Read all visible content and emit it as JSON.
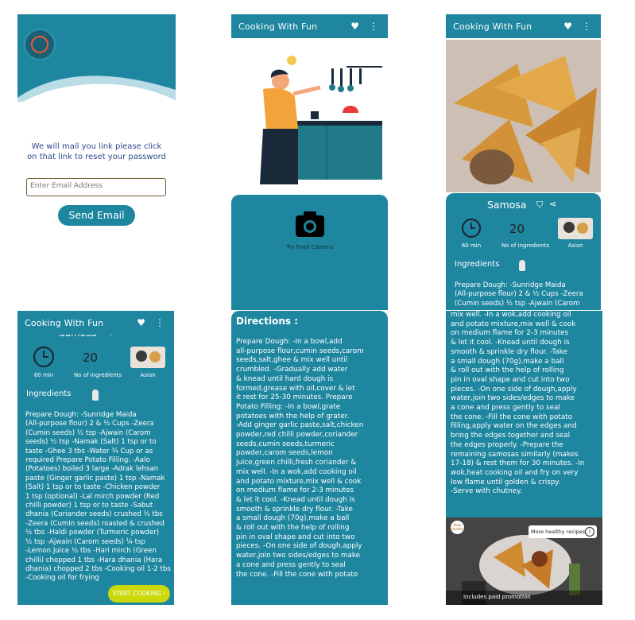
{
  "app": {
    "title": "Cooking With Fun"
  },
  "colors": {
    "primary": "#1f86a0",
    "button": "#cbd90b",
    "light_bg": "#ffffff"
  },
  "reset": {
    "message": "We will mail you link please click\non that link to reset your password",
    "email_placeholder": "Enter Email Address",
    "send_button": "Send Email"
  },
  "camera": {
    "label": "Try Food Camera"
  },
  "recipe": {
    "name": "Samosa",
    "name_partial": "Samosa",
    "time": "60 min",
    "ingredients_count": "20",
    "ingredients_count_label": "No of ingredients",
    "cuisine": "Asian",
    "ingredients_heading": "Ingredients",
    "ingredients_preview": "Prepare Dough: -Sunridge Maida\n(All-purpose flour) 2 & ½ Cups -Zeera\n(Cumin seeds) ½ tsp -Ajwain (Carom",
    "ingredients_full": "Prepare Dough: -Sunridge Maida\n(All-purpose flour) 2 & ½ Cups -Zeera\n(Cumin seeds) ½ tsp -Ajwain (Carom\nseeds) ½ tsp -Namak (Salt) 1 tsp or to\ntaste -Ghee 3 tbs -Water ¾ Cup or as\nrequired Prepare Potato Filling: -Aalo\n(Potatoes) boiled 3 large -Adrak lehsan\npaste (Ginger garlic paste) 1 tsp -Namak\n(Salt) 1 tsp or to taste -Chicken powder\n1 tsp (optional) -Lal mirch powder (Red\nchilli powder) 1 tsp or to taste -Sabut\ndhania (Coriander seeds) crushed ½ tbs\n-Zeera (Cumin seeds) roasted & crushed\n½ tbs -Haldi powder (Turmeric powder)\n½ tsp -Ajwain (Carom seeds) ¼ tsp\n-Lemon Juice ½ tbs -Hari mirch (Green\nchilli) chopped 1 tbs -Hara dhania (Hara\ndhania) chopped 2 tbs -Cooking oil 1-2 tbs\n-Cooking oil for frying",
    "start_button": "START COOKING"
  },
  "directions": {
    "heading": "Directions :",
    "text1": "Prepare Dough: -In a bowl,add\nall-purpose flour,cumin seeds,carom\nseeds,salt,ghee & mix well until\ncrumbled. -Gradually add water\n& knead until hard dough is\nformed,grease with oil,cover & let\nit rest for 25-30 minutes. Prepare\nPotato Filling: -In a bowl,grate\npotatoes with the help of grater.\n-Add ginger garlic paste,salt,chicken\npowder,red chilli powder,coriander\nseeds,cumin seeds,turmeric\npowder,carom seeds,lemon\njuice,green chilli,fresh coriander &\nmix well. -In a wok,add cooking oil\nand potato mixture,mix well & cook\non medium flame for 2-3 minutes\n& let it cool. -Knead until dough is\nsmooth & sprinkle dry flour. -Take\na small dough (70g),make a ball\n& roll out with the help of rolling\npin in oval shape and cut into two\npieces. -On one side of dough,apply\nwater,join two sides/edges to make\na cone and press gently to seal\nthe cone. -Fill the cone with potato",
    "text2": "mix well. -In a wok,add cooking oil\nand potato mixture,mix well & cook\non medium flame for 2-3 minutes\n& let it cool. -Knead until dough is\nsmooth & sprinkle dry flour. -Take\na small dough (70g),make a ball\n& roll out with the help of rolling\npin in oval shape and cut into two\npieces. -On one side of dough,apply\nwater,join two sides/edges to make\na cone and press gently to seal\nthe cone. -Fill the cone with potato\nfilling,apply water on the edges and\nbring the edges together and seal\nthe edges properly. -Prepare the\nremaining samosas similarly (makes\n17-18) & rest them for 30 minutes. -In\nwok,heat cooking oil and fry on very\nlow flame until golden & crispy.\n-Serve with chutney."
  },
  "ad": {
    "headline": "More healthy recipes",
    "footer": "Includes paid promotion",
    "badge": "Bake Healthy"
  }
}
